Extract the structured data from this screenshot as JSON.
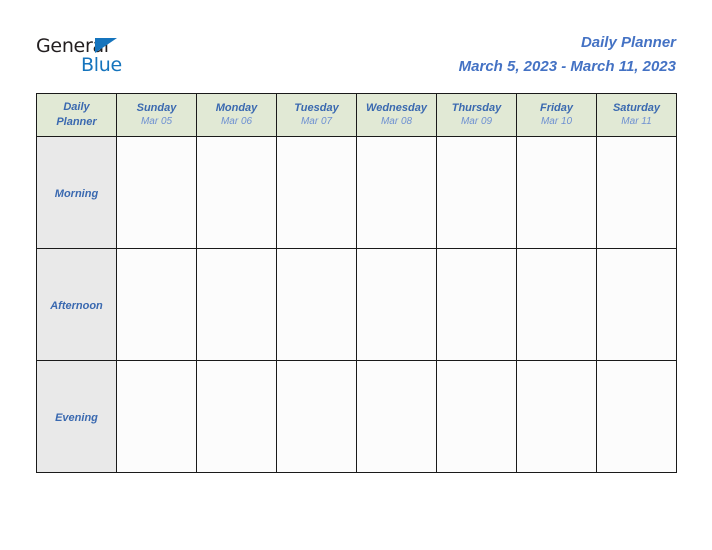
{
  "logo": {
    "word_one": "General",
    "word_two": "Blue",
    "triangle_icon": "triangle-icon",
    "brand_blue": "#1574bd",
    "brand_dark": "#231f20"
  },
  "header": {
    "title": "Daily Planner",
    "subtitle": "March 5, 2023 - March 11, 2023",
    "accent_color": "#4472c4"
  },
  "table": {
    "corner": {
      "line1": "Daily",
      "line2": "Planner"
    },
    "header_bg": "#e1e9d5",
    "row_label_bg": "#e9e9e9",
    "cell_bg": "#fcfcfc",
    "border_color": "#1a1a1a",
    "day_name_color": "#3a69b0",
    "day_date_color": "#6d90d2",
    "columns": [
      {
        "day": "Sunday",
        "date": "Mar 05"
      },
      {
        "day": "Monday",
        "date": "Mar 06"
      },
      {
        "day": "Tuesday",
        "date": "Mar 07"
      },
      {
        "day": "Wednesday",
        "date": "Mar 08"
      },
      {
        "day": "Thursday",
        "date": "Mar 09"
      },
      {
        "day": "Friday",
        "date": "Mar 10"
      },
      {
        "day": "Saturday",
        "date": "Mar 11"
      }
    ],
    "rows": [
      {
        "label": "Morning",
        "cells": [
          "",
          "",
          "",
          "",
          "",
          "",
          ""
        ]
      },
      {
        "label": "Afternoon",
        "cells": [
          "",
          "",
          "",
          "",
          "",
          "",
          ""
        ]
      },
      {
        "label": "Evening",
        "cells": [
          "",
          "",
          "",
          "",
          "",
          "",
          ""
        ]
      }
    ]
  }
}
